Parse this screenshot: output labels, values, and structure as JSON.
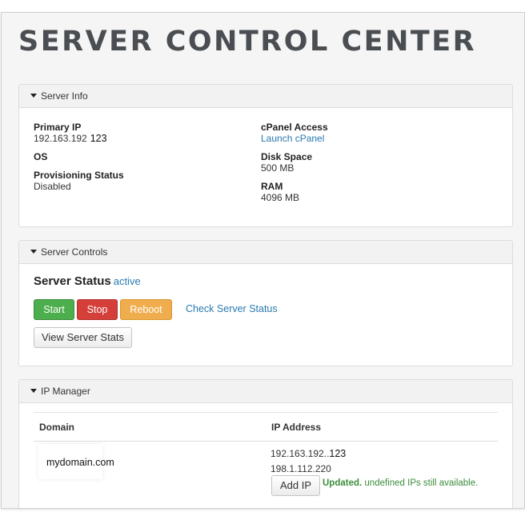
{
  "page": {
    "title": "SERVER CONTROL CENTER"
  },
  "server_info": {
    "header": "Server Info",
    "primary_ip_label": "Primary IP",
    "primary_ip_value": "192.163.192",
    "primary_ip_suffix": "123",
    "os_label": "OS",
    "provisioning_label": "Provisioning Status",
    "provisioning_value": "Disabled",
    "cpanel_label": "cPanel Access",
    "cpanel_link": "Launch cPanel",
    "disk_label": "Disk Space",
    "disk_value": "500 MB",
    "ram_label": "RAM",
    "ram_value": "4096 MB"
  },
  "server_controls": {
    "header": "Server Controls",
    "status_label": "Server Status",
    "status_value": "active",
    "start_label": "Start",
    "stop_label": "Stop",
    "reboot_label": "Reboot",
    "check_label": "Check Server Status",
    "stats_label": "View Server Stats"
  },
  "ip_manager": {
    "header": "IP Manager",
    "col_domain": "Domain",
    "col_ip": "IP Address",
    "domain": "mydomain.com",
    "ip_1_prefix": "192.163.192..",
    "ip_1_suffix": "123",
    "ip_2": "198.1.112.220",
    "add_ip_label": "Add IP",
    "updated_bold": "Updated.",
    "updated_rest": "undefined IPs still available."
  },
  "colors": {
    "start": "#4cae4c",
    "stop": "#d43f3a",
    "reboot": "#f0ad4e",
    "link": "#2a7ab0",
    "success": "#3c8d3c"
  }
}
